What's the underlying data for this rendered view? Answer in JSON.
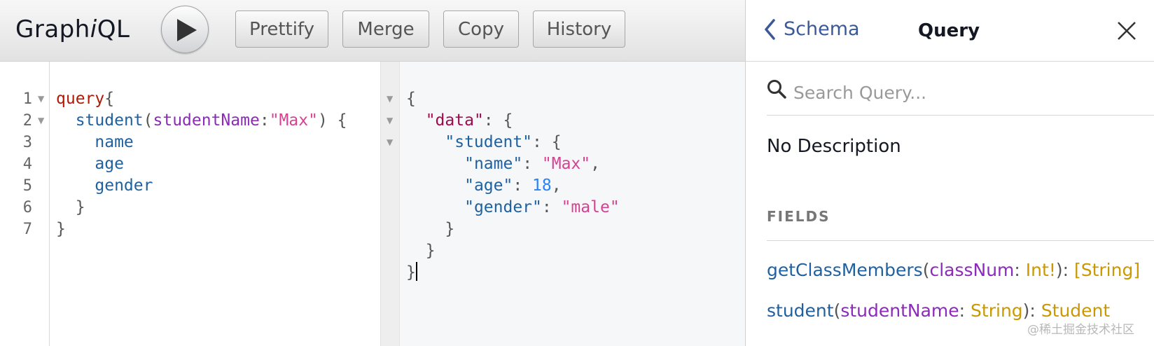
{
  "toolbar": {
    "logo_before": "Graph",
    "logo_italic": "i",
    "logo_after": "QL",
    "run_icon": "play-icon",
    "prettify": "Prettify",
    "merge": "Merge",
    "copy": "Copy",
    "history": "History"
  },
  "query_editor": {
    "line_numbers": [
      "1",
      "2",
      "3",
      "4",
      "5",
      "6",
      "7"
    ],
    "lines": [
      [
        "query",
        "{"
      ],
      [
        "  ",
        "student",
        "(",
        "studentName",
        ":",
        "\"Max\"",
        ") {"
      ],
      [
        "    ",
        "name"
      ],
      [
        "    ",
        "age"
      ],
      [
        "    ",
        "gender"
      ],
      [
        "  ",
        "}"
      ],
      [
        "",
        "}"
      ]
    ]
  },
  "result": {
    "lines": [
      [
        "{"
      ],
      [
        "  ",
        "\"data\"",
        ": {"
      ],
      [
        "    ",
        "\"student\"",
        ": {"
      ],
      [
        "      ",
        "\"name\"",
        ": ",
        "\"Max\"",
        ","
      ],
      [
        "      ",
        "\"age\"",
        ": ",
        "18",
        ","
      ],
      [
        "      ",
        "\"gender\"",
        ": ",
        "\"male\""
      ],
      [
        "    ",
        "}"
      ],
      [
        "  ",
        "}"
      ],
      [
        "}"
      ]
    ]
  },
  "docs": {
    "back_label": "Schema",
    "title": "Query",
    "search_placeholder": "Search Query...",
    "description": "No Description",
    "fields_heading": "FIELDS",
    "fields": [
      {
        "name": "getClassMembers",
        "open": "(",
        "arg": "classNum",
        "colon": ": ",
        "arg_type": "Int!",
        "close": "): ",
        "ret": "[String]"
      },
      {
        "name": "student",
        "open": "(",
        "arg": "studentName",
        "colon": ": ",
        "arg_type": "String",
        "close": "): ",
        "ret": "Student"
      }
    ]
  },
  "watermark": "@稀土掘金技术社区"
}
